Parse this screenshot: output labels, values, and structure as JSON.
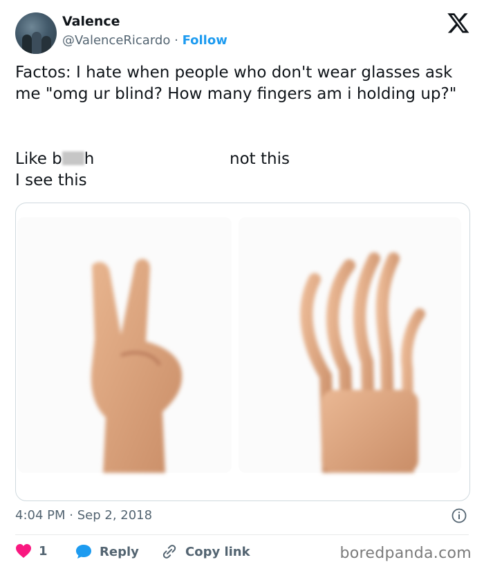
{
  "header": {
    "display_name": "Valence",
    "handle": "@ValenceRicardo",
    "separator": "·",
    "follow_label": "Follow",
    "logo": "X"
  },
  "tweet": {
    "text": "Factos: I hate when people who don't wear glasses ask me \"omg ur blind? How many fingers am i holding up?\"",
    "caption_left_start": "Like b",
    "caption_left_end": "h",
    "caption_left_line2": "I see this",
    "caption_right": "not this"
  },
  "media": {
    "left_image": "blurred-two-finger-peace-sign-hand",
    "right_image": "wavy-distorted-hand"
  },
  "meta": {
    "time": "4:04 PM",
    "separator": "·",
    "date": "Sep 2, 2018"
  },
  "actions": {
    "like_count": "1",
    "reply_label": "Reply",
    "copy_label": "Copy link"
  },
  "colors": {
    "accent": "#1d9bf0",
    "like": "#f91880",
    "muted": "#536471",
    "border": "#cfd9de"
  },
  "watermark": "boredpanda.com"
}
